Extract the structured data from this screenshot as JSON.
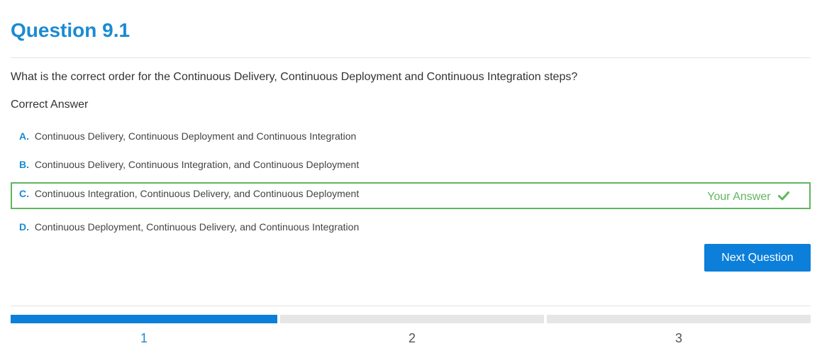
{
  "page_title": "Question 9.1",
  "question_text": "What is the correct order for the Continuous Delivery, Continuous Deployment and Continuous Integration steps?",
  "correct_answer_label": "Correct Answer",
  "options": [
    {
      "letter": "A.",
      "text": "Continuous Delivery, Continuous Deployment and Continuous Integration"
    },
    {
      "letter": "B.",
      "text": "Continuous Delivery, Continuous Integration, and Continuous Deployment"
    },
    {
      "letter": "C.",
      "text": "Continuous Integration, Continuous Delivery, and Continuous Deployment",
      "selected": true
    },
    {
      "letter": "D.",
      "text": "Continuous Deployment, Continuous Delivery, and Continuous Integration"
    }
  ],
  "your_answer_label": "Your Answer",
  "your_answer_icon": "check-icon",
  "next_button_label": "Next Question",
  "progress_steps": [
    {
      "label": "1",
      "active": true
    },
    {
      "label": "2",
      "active": false
    },
    {
      "label": "3",
      "active": false
    }
  ],
  "colors": {
    "accent": "#1a8bd1",
    "button": "#0b7fd9",
    "correct": "#5fb75f",
    "progress_inactive": "#e6e6e6"
  }
}
